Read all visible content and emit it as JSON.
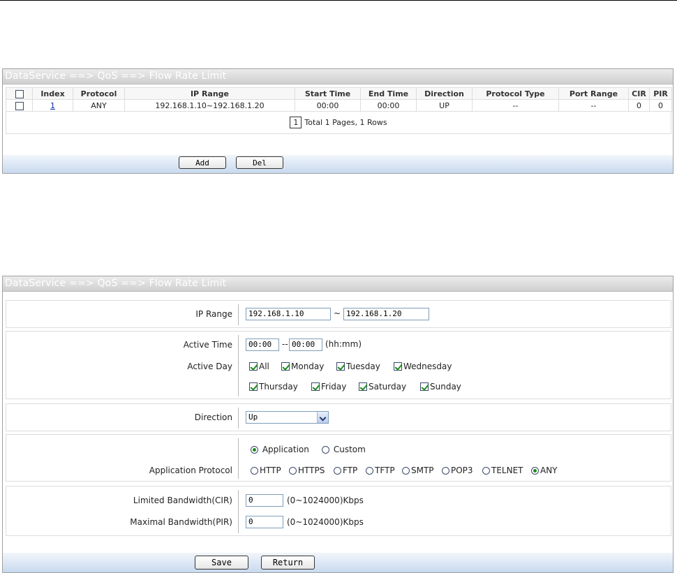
{
  "list_panel": {
    "title": "DataService ==> QoS ==> Flow Rate Limit",
    "columns": [
      "Index",
      "Protocol",
      "IP Range",
      "Start Time",
      "End Time",
      "Direction",
      "Protocol Type",
      "Port Range",
      "CIR",
      "PIR"
    ],
    "rows": [
      {
        "index": "1",
        "protocol": "ANY",
        "ip_range": "192.168.1.10~192.168.1.20",
        "start_time": "00:00",
        "end_time": "00:00",
        "direction": "UP",
        "protocol_type": "--",
        "port_range": "--",
        "cir": "0",
        "pir": "0"
      }
    ],
    "pager": {
      "current_page": "1",
      "summary": "Total 1 Pages, 1 Rows"
    },
    "buttons": {
      "add": "Add",
      "del": "Del"
    }
  },
  "form_panel": {
    "title": "DataService ==> QoS ==> Flow Rate Limit",
    "ip_range": {
      "label": "IP Range",
      "start": "192.168.1.10",
      "separator": "~",
      "end": "192.168.1.20"
    },
    "active_time": {
      "label": "Active Time",
      "start": "00:00",
      "separator": "--",
      "end": "00:00",
      "hint": "(hh:mm)"
    },
    "active_day": {
      "label": "Active Day",
      "days": [
        {
          "name": "All",
          "checked": true
        },
        {
          "name": "Monday",
          "checked": true
        },
        {
          "name": "Tuesday",
          "checked": true
        },
        {
          "name": "Wednesday",
          "checked": true
        },
        {
          "name": "Thursday",
          "checked": true
        },
        {
          "name": "Friday",
          "checked": true
        },
        {
          "name": "Saturday",
          "checked": true
        },
        {
          "name": "Sunday",
          "checked": true
        }
      ]
    },
    "direction": {
      "label": "Direction",
      "value": "Up"
    },
    "protocol_mode": {
      "application": "Application",
      "custom": "Custom",
      "selected": "Application"
    },
    "application_protocol": {
      "label": "Application Protocol",
      "options": [
        "HTTP",
        "HTTPS",
        "FTP",
        "TFTP",
        "SMTP",
        "POP3",
        "TELNET",
        "ANY"
      ],
      "selected": "ANY"
    },
    "cir": {
      "label": "Limited Bandwidth(CIR)",
      "value": "0",
      "hint": "(0~1024000)Kbps"
    },
    "pir": {
      "label": "Maximal Bandwidth(PIR)",
      "value": "0",
      "hint": "(0~1024000)Kbps"
    },
    "buttons": {
      "save": "Save",
      "return": "Return"
    }
  },
  "colors": {
    "title_bar": "#d8d8d8",
    "footer_bar": "#c8daef",
    "check_mark": "#1e8a1e",
    "link": "#0b2aa8"
  }
}
